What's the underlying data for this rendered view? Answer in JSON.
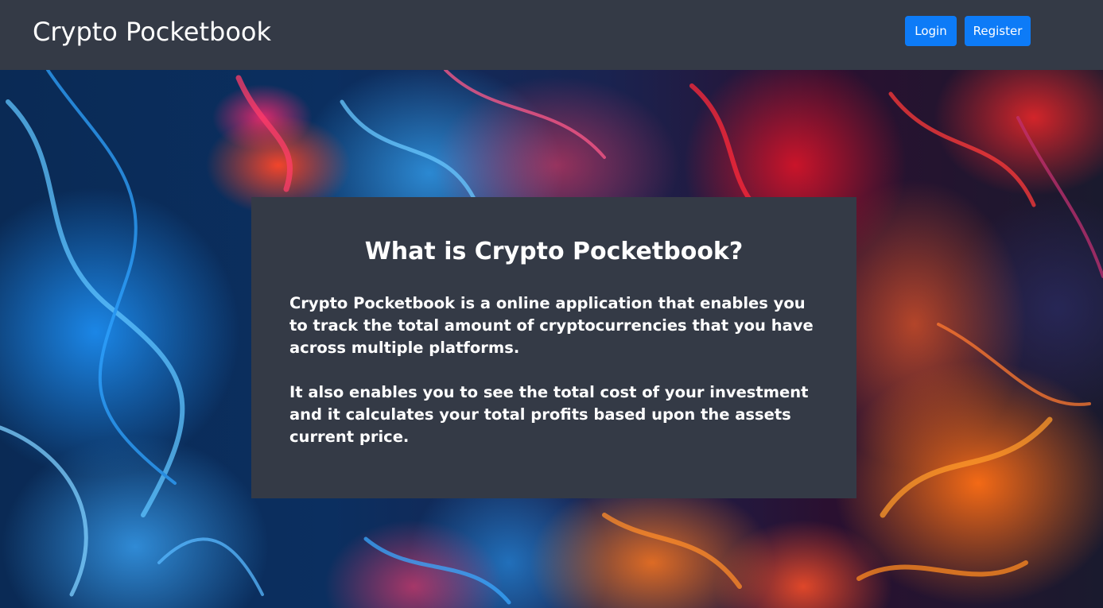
{
  "navbar": {
    "brand": "Crypto Pocketbook",
    "login_label": "Login",
    "register_label": "Register"
  },
  "info_card": {
    "title": "What is Crypto Pocketbook?",
    "paragraphs": [
      "Crypto Pocketbook is a online application that enables you to track the total amount of cryptocurrencies that you have across multiple platforms.",
      "It also enables you to see the total cost of your investment and it calculates your total profits based upon the assets current price."
    ]
  },
  "colors": {
    "navbar_bg": "#343a46",
    "card_bg": "#343a46",
    "button_bg": "#0d7bf7",
    "text": "#ffffff"
  }
}
